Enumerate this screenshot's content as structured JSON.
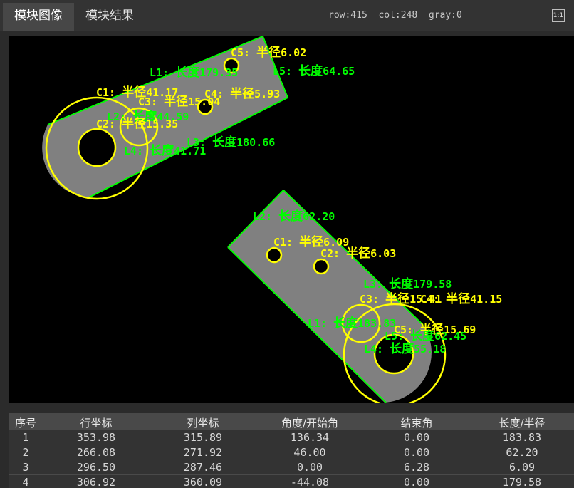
{
  "tabs": [
    {
      "label": "模块图像",
      "active": true
    },
    {
      "label": "模块结果",
      "active": false
    }
  ],
  "status": "row:415  col:248  gray:0",
  "fit_button": "1:1",
  "colors": {
    "part_fill": "#808080",
    "line_color": "#00ff00",
    "circle_color": "#ffff00",
    "hole_fill": "#000000"
  },
  "overlay": {
    "part_a": {
      "labels": [
        {
          "id": "C5",
          "prefix": "C5: ",
          "word": "半径",
          "value": "6.02",
          "kind": "circle"
        },
        {
          "id": "L1",
          "prefix": "L1: ",
          "word": "长度",
          "value": "179.35",
          "kind": "line"
        },
        {
          "id": "L5",
          "prefix": "L5: ",
          "word": "长度",
          "value": "64.65",
          "kind": "line"
        },
        {
          "id": "C1",
          "prefix": "C1: ",
          "word": "半径",
          "value": "41.17",
          "kind": "circle"
        },
        {
          "id": "C4",
          "prefix": "C4: ",
          "word": "半径",
          "value": "5.93",
          "kind": "circle"
        },
        {
          "id": "C3",
          "prefix": "C3: ",
          "word": "半径",
          "value": "15.04",
          "kind": "circle"
        },
        {
          "id": "L2",
          "prefix": "L2: ",
          "word": "长度",
          "value": "44.59",
          "kind": "line"
        },
        {
          "id": "C2",
          "prefix": "C2: ",
          "word": "半径",
          "value": "15.35",
          "kind": "circle"
        },
        {
          "id": "L3",
          "prefix": "L3: ",
          "word": "长度",
          "value": "180.66",
          "kind": "line"
        },
        {
          "id": "L4",
          "prefix": "L4: ",
          "word": "长度",
          "value": "41.71",
          "kind": "line"
        }
      ]
    },
    "part_b": {
      "labels": [
        {
          "id": "L2",
          "prefix": "L2: ",
          "word": "长度",
          "value": "62.20",
          "kind": "line"
        },
        {
          "id": "C1",
          "prefix": "C1: ",
          "word": "半径",
          "value": "6.09",
          "kind": "circle"
        },
        {
          "id": "C2",
          "prefix": "C2: ",
          "word": "半径",
          "value": "6.03",
          "kind": "circle"
        },
        {
          "id": "L3",
          "prefix": "L3: ",
          "word": "长度",
          "value": "179.58",
          "kind": "line"
        },
        {
          "id": "C3",
          "prefix": "C3: ",
          "word": "半径",
          "value": "15.41",
          "kind": "circle"
        },
        {
          "id": "C4",
          "prefix": "C4: ",
          "word": "半径",
          "value": "41.15",
          "kind": "circle"
        },
        {
          "id": "L1",
          "prefix": "L1: ",
          "word": "长度",
          "value": "183.83",
          "kind": "line"
        },
        {
          "id": "C5",
          "prefix": "C5: ",
          "word": "半径",
          "value": "15.69",
          "kind": "circle"
        },
        {
          "id": "L5",
          "prefix": "L5: ",
          "word": "长度",
          "value": "62.45",
          "kind": "line"
        },
        {
          "id": "L4",
          "prefix": "L4: ",
          "word": "长度",
          "value": "55.18",
          "kind": "line"
        }
      ]
    }
  },
  "table": {
    "headers": [
      "序号",
      "行坐标",
      "列坐标",
      "角度/开始角",
      "结束角",
      "长度/半径"
    ],
    "rows": [
      [
        "1",
        "353.98",
        "315.89",
        "136.34",
        "0.00",
        "183.83"
      ],
      [
        "2",
        "266.08",
        "271.92",
        "46.00",
        "0.00",
        "62.20"
      ],
      [
        "3",
        "296.50",
        "287.46",
        "0.00",
        "6.28",
        "6.09"
      ],
      [
        "4",
        "306.92",
        "360.09",
        "-44.08",
        "0.00",
        "179.58"
      ]
    ]
  }
}
